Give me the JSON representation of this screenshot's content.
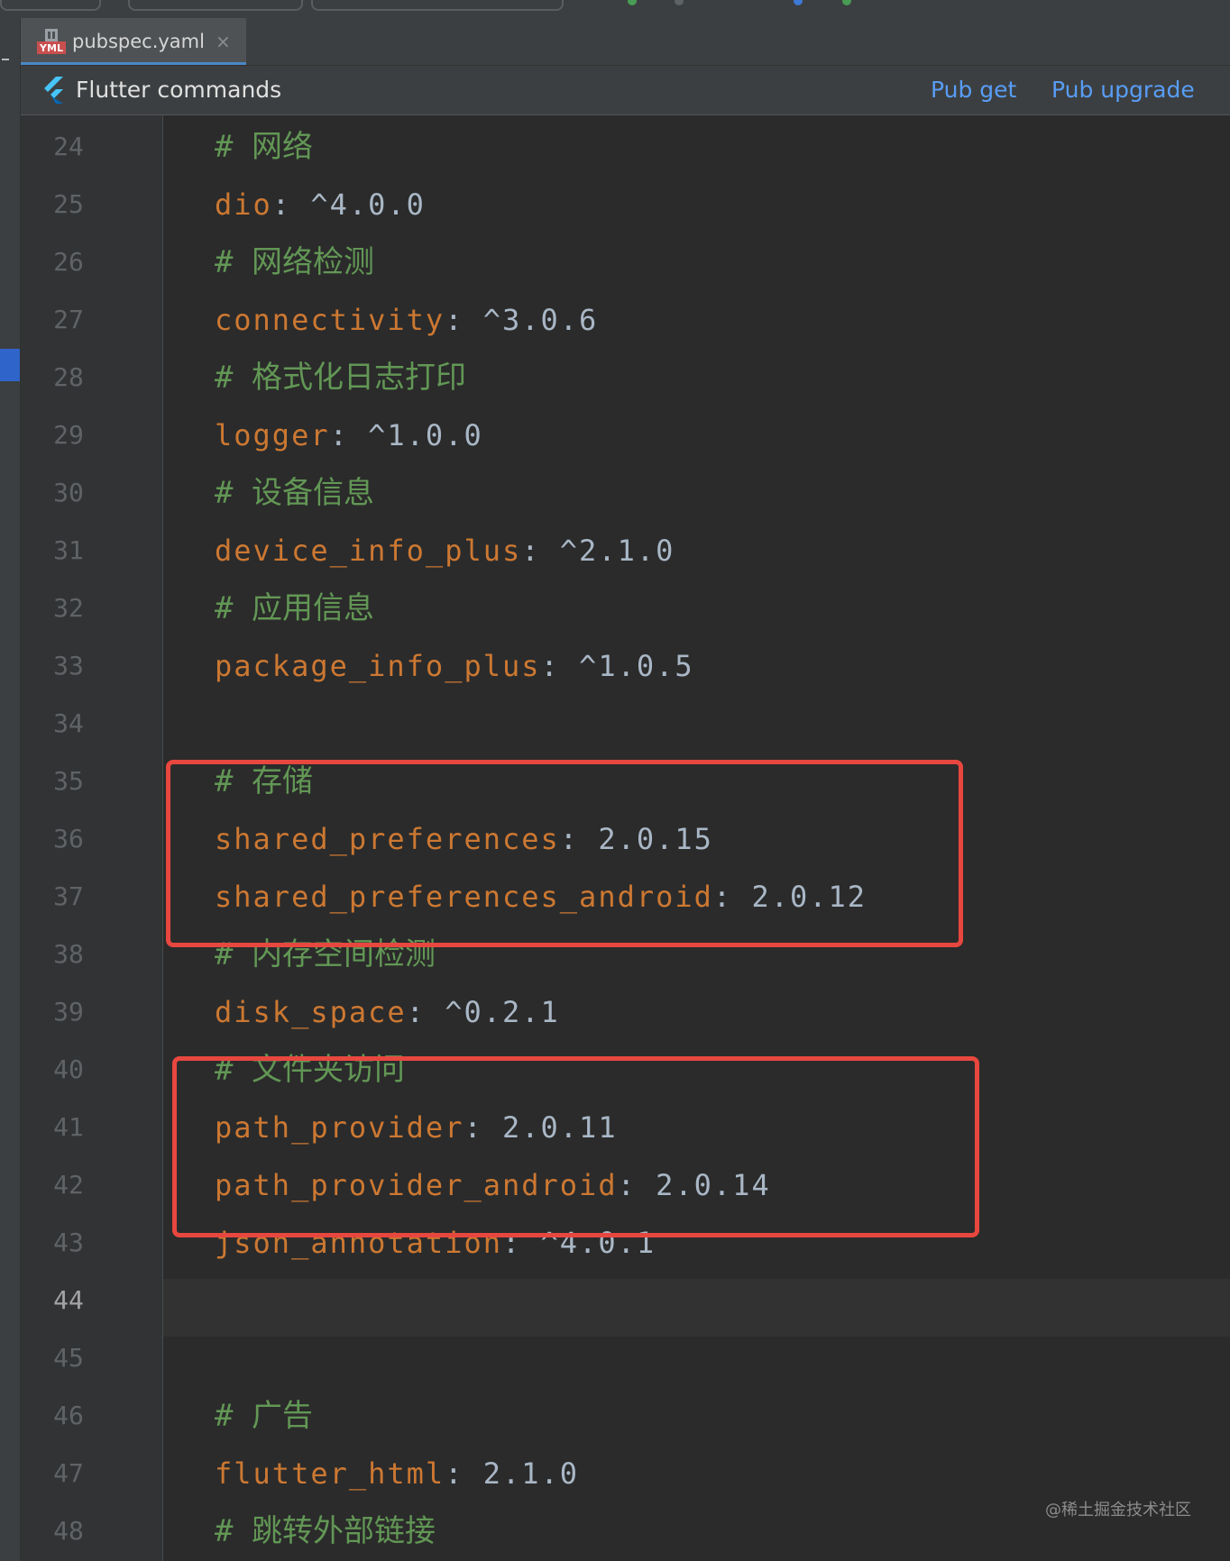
{
  "tab": {
    "icon": "yml-file-icon",
    "icon_text": "YML",
    "label": "pubspec.yaml",
    "close": "×"
  },
  "flutter_bar": {
    "title": "Flutter commands",
    "pub_get": "Pub get",
    "pub_upgrade": "Pub upgrade"
  },
  "lines": [
    {
      "num": "24",
      "type": "comment",
      "text": "网络"
    },
    {
      "num": "25",
      "type": "entry",
      "key": "dio",
      "value": "^4.0.0"
    },
    {
      "num": "26",
      "type": "comment",
      "text": "网络检测"
    },
    {
      "num": "27",
      "type": "entry",
      "key": "connectivity",
      "value": "^3.0.6"
    },
    {
      "num": "28",
      "type": "comment",
      "text": "格式化日志打印"
    },
    {
      "num": "29",
      "type": "entry",
      "key": "logger",
      "value": "^1.0.0"
    },
    {
      "num": "30",
      "type": "comment",
      "text": "设备信息"
    },
    {
      "num": "31",
      "type": "entry",
      "key": "device_info_plus",
      "value": "^2.1.0"
    },
    {
      "num": "32",
      "type": "comment",
      "text": "应用信息"
    },
    {
      "num": "33",
      "type": "entry",
      "key": "package_info_plus",
      "value": "^1.0.5"
    },
    {
      "num": "34",
      "type": "blank"
    },
    {
      "num": "35",
      "type": "comment",
      "text": "存储"
    },
    {
      "num": "36",
      "type": "entry",
      "key": "shared_preferences",
      "value": "2.0.15"
    },
    {
      "num": "37",
      "type": "entry",
      "key": "shared_preferences_android",
      "value": "2.0.12"
    },
    {
      "num": "38",
      "type": "comment",
      "text": "内存空间检测"
    },
    {
      "num": "39",
      "type": "entry",
      "key": "disk_space",
      "value": "^0.2.1"
    },
    {
      "num": "40",
      "type": "comment",
      "text": "文件夹访问"
    },
    {
      "num": "41",
      "type": "entry",
      "key": "path_provider",
      "value": "2.0.11"
    },
    {
      "num": "42",
      "type": "entry",
      "key": "path_provider_android",
      "value": "2.0.14"
    },
    {
      "num": "43",
      "type": "entry",
      "key": "json_annotation",
      "value": "^4.0.1"
    },
    {
      "num": "44",
      "type": "blank",
      "current": true
    },
    {
      "num": "45",
      "type": "blank"
    },
    {
      "num": "46",
      "type": "comment",
      "text": "广告"
    },
    {
      "num": "47",
      "type": "entry",
      "key": "flutter_html",
      "value": "2.1.0"
    },
    {
      "num": "48",
      "type": "comment",
      "text": "跳转外部链接"
    }
  ],
  "comment_prefix": "# ",
  "separator": ": ",
  "colors": {
    "background": "#2b2b2b",
    "key": "#cc7832",
    "value": "#a9b7c6",
    "comment": "#629755",
    "line_number": "#606366",
    "link": "#589df6",
    "highlight_border": "#e8473f"
  },
  "watermark": "@稀土掘金技术社区"
}
